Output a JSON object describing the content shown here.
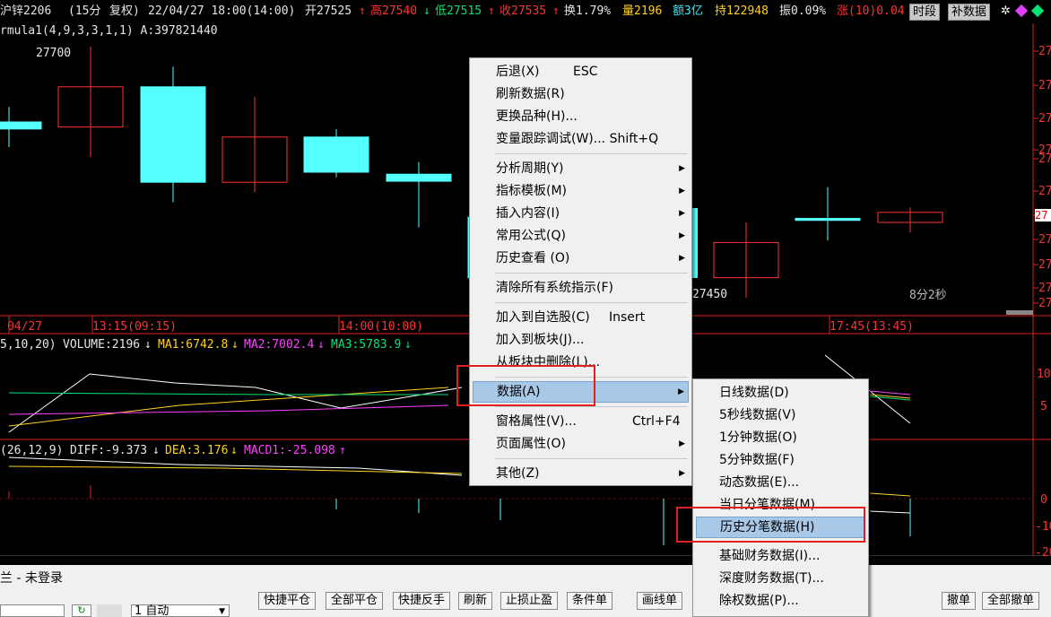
{
  "header": {
    "contract": "沪锌2206",
    "period": "(15分",
    "adjust": "复权)",
    "datetime": "22/04/27 18:00(14:00)",
    "open": "开27525",
    "open_arrow": "↑",
    "high": "高27540",
    "high_arrow": "↓",
    "low": "低27515",
    "low_arrow": "↑",
    "close": "收27535",
    "close_arrow": "↑",
    "turnover": "换1.79%",
    "volume": "量2196",
    "amount": "额3亿",
    "position": "持122948",
    "amplitude": "振0.09%",
    "change": "涨(10)0.04",
    "btn_timeperiod": "时段",
    "btn_supplement": "补数据"
  },
  "main_panel": {
    "formula_line": "rmula1(4,9,3,3,1,1)  A:397821440",
    "high_label": "27700",
    "low_label": "27450",
    "countdown": "8分2秒",
    "price_ticks": [
      "27",
      "27",
      "27",
      "27",
      "27",
      "27",
      "27",
      "27",
      "27",
      "27"
    ],
    "price_tag": "27"
  },
  "time_axis": {
    "labels": [
      "04/27",
      "13:15(09:15)",
      "14:00(10:00)",
      "17:45(13:45)"
    ]
  },
  "volume_panel": {
    "params": "5,10,20)",
    "volume": "VOLUME:2196",
    "volume_arrow": "↓",
    "ma1": "MA1:6742.8",
    "ma1_arrow": "↓",
    "ma2": "MA2:7002.4",
    "ma2_arrow": "↓",
    "ma3": "MA3:5783.9",
    "ma3_arrow": "↓",
    "ticks": [
      "10",
      "5"
    ]
  },
  "macd_panel": {
    "params": "(26,12,9)",
    "diff": "DIFF:-9.373",
    "diff_arrow": "↓",
    "dea": "DEA:3.176",
    "dea_arrow": "↓",
    "macd": "MACD1:-25.098",
    "macd_arrow": "↑",
    "ticks": [
      "0",
      "-10",
      "-20"
    ]
  },
  "context_menu": {
    "items": [
      {
        "label": "后退(X)",
        "shortcut": "ESC",
        "submenu": false
      },
      {
        "label": "刷新数据(R)",
        "shortcut": "",
        "submenu": false
      },
      {
        "label": "更换品种(H)...",
        "shortcut": "",
        "submenu": false
      },
      {
        "label": "变量跟踪调试(W)... Shift+Q",
        "shortcut": "",
        "submenu": false
      },
      {
        "label": "分析周期(Y)",
        "shortcut": "",
        "submenu": true
      },
      {
        "label": "指标模板(M)",
        "shortcut": "",
        "submenu": true
      },
      {
        "label": "插入内容(I)",
        "shortcut": "",
        "submenu": true
      },
      {
        "label": "常用公式(Q)",
        "shortcut": "",
        "submenu": true
      },
      {
        "label": "历史查看 (O)",
        "shortcut": "",
        "submenu": true
      },
      {
        "label": "清除所有系统指示(F)",
        "shortcut": "",
        "submenu": false
      },
      {
        "label": "加入到自选股(C)",
        "shortcut": "Insert",
        "submenu": false
      },
      {
        "label": "加入到板块(J)...",
        "shortcut": "",
        "submenu": false
      },
      {
        "label": "从板块中删除(L)...",
        "shortcut": "",
        "submenu": false
      },
      {
        "label": "数据(A)",
        "shortcut": "",
        "submenu": true
      },
      {
        "label": "窗格属性(V)...",
        "shortcut": "Ctrl+F4",
        "submenu": false
      },
      {
        "label": "页面属性(O)",
        "shortcut": "",
        "submenu": true
      },
      {
        "label": "其他(Z)",
        "shortcut": "",
        "submenu": true
      }
    ]
  },
  "data_submenu": {
    "items": [
      {
        "label": "日线数据(D)"
      },
      {
        "label": "5秒线数据(V)"
      },
      {
        "label": "1分钟数据(O)"
      },
      {
        "label": "5分钟数据(F)"
      },
      {
        "label": "动态数据(E)..."
      },
      {
        "label": "当日分笔数据(M)"
      },
      {
        "label": "历史分笔数据(H)"
      },
      {
        "label": "基础财务数据(I)..."
      },
      {
        "label": "深度财务数据(T)..."
      },
      {
        "label": "除权数据(P)..."
      }
    ]
  },
  "bottom_bar": {
    "title": "兰 - 未登录",
    "auto_label": "1 自动",
    "buttons": [
      "快捷平仓",
      "全部平仓",
      "快捷反手",
      "刷新",
      "止损止盈",
      "条件单",
      "画线单",
      "撤单",
      "全部撤单"
    ]
  },
  "colors": {
    "background": "#000000",
    "up_candle": "#ff3232",
    "down_candle": "#54ffff",
    "menu_bg": "#f0f0f0",
    "highlight": "#a8c8e8",
    "annotation": "#e02020"
  },
  "chart_data": {
    "type": "candlestick",
    "title": "沪锌2206 (15分 复权)",
    "candles": [
      {
        "open": 27625,
        "close": 27618,
        "high": 27640,
        "low": 27600
      },
      {
        "open": 27620,
        "close": 27660,
        "high": 27700,
        "low": 27590
      },
      {
        "open": 27660,
        "close": 27565,
        "high": 27680,
        "low": 27545
      },
      {
        "open": 27565,
        "close": 27610,
        "high": 27650,
        "low": 27555
      },
      {
        "open": 27610,
        "close": 27575,
        "high": 27618,
        "low": 27570
      },
      {
        "open": 27573,
        "close": 27566,
        "high": 27585,
        "low": 27520
      },
      {
        "open": 27530,
        "close": 27470,
        "high": 27545,
        "low": 27465
      },
      {
        "open": 27470,
        "close": 27505,
        "high": 27525,
        "low": 27450
      },
      {
        "open": 27529,
        "close": 27527,
        "high": 27560,
        "low": 27507
      },
      {
        "open": 27525,
        "close": 27535,
        "high": 27540,
        "low": 27515
      }
    ],
    "volume_ma": {
      "VOLUME": 2196,
      "MA1": 6742.8,
      "MA2": 7002.4,
      "MA3": 5783.9
    },
    "macd": {
      "DIFF": -9.373,
      "DEA": 3.176,
      "MACD1": -25.098
    }
  }
}
